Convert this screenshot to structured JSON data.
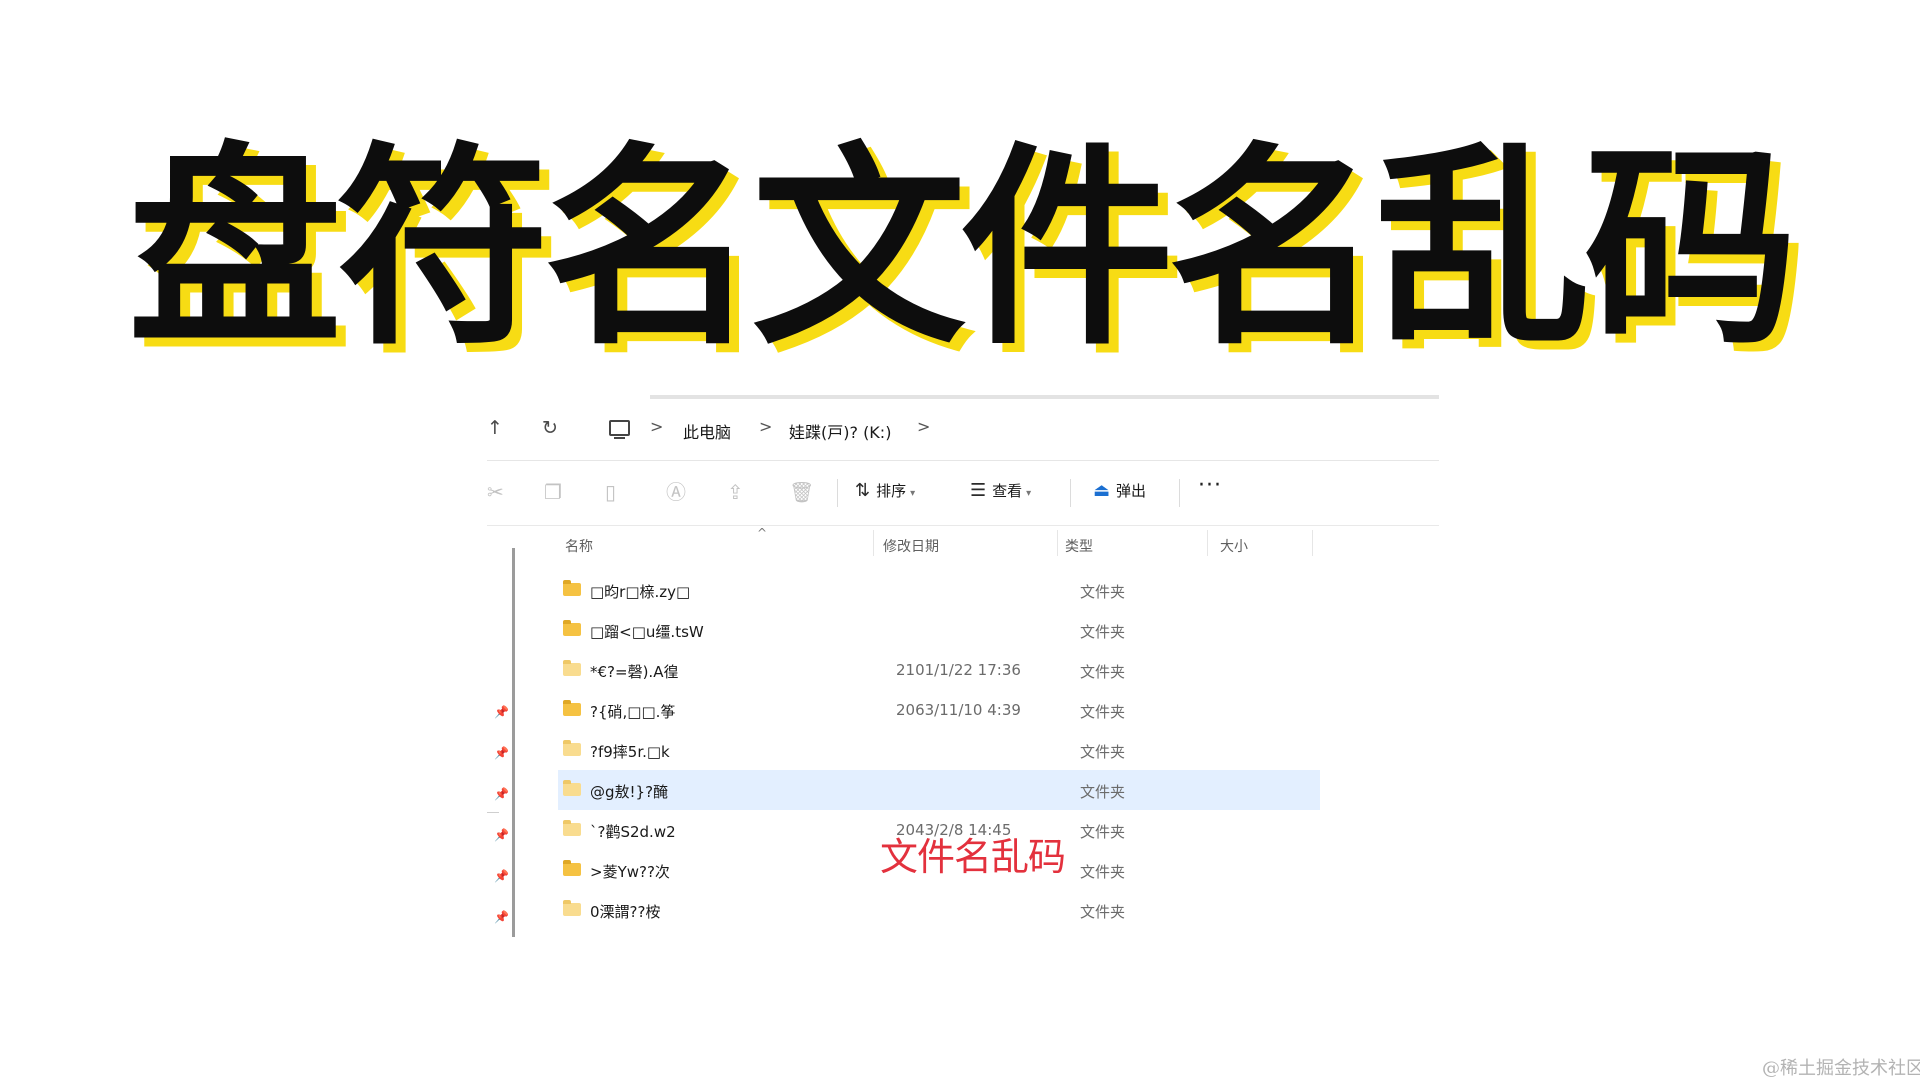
{
  "headline": "盘符名文件名乱码",
  "annotation": "文件名乱码",
  "watermark": "@稀土掘金技术社区",
  "explorer": {
    "nav": {
      "up_icon": "↑",
      "refresh_icon": "↻"
    },
    "breadcrumb": {
      "separator": ">",
      "items": [
        "此电脑",
        "娃蹀(戸)? (K:)"
      ]
    },
    "toolbar": {
      "sort_label": "排序",
      "view_label": "查看",
      "eject_label": "弹出",
      "more_label": "···",
      "icons": [
        "cut-icon",
        "copy-icon",
        "paste-icon",
        "rename-icon",
        "share-icon",
        "delete-icon"
      ]
    },
    "columns": {
      "name": "名称",
      "modified": "修改日期",
      "type": "类型",
      "size": "大小"
    },
    "files": [
      {
        "name": "□昀r□榇.zy□",
        "date": "",
        "type": "文件夹"
      },
      {
        "name": "□蹓<□u缰.tsW",
        "date": "",
        "type": "文件夹"
      },
      {
        "name": "*€?=磬).A徨",
        "date": "2101/1/22 17:36",
        "type": "文件夹"
      },
      {
        "name": "?{硝,□□.筝",
        "date": "2063/11/10 4:39",
        "type": "文件夹"
      },
      {
        "name": "?f9摔5r.□k",
        "date": "",
        "type": "文件夹"
      },
      {
        "name": "@g敖!}?醃",
        "date": "",
        "type": "文件夹",
        "selected": true
      },
      {
        "name": "`?鹳S2d.w2",
        "date": "2043/2/8 14:45",
        "type": "文件夹"
      },
      {
        "name": ">菱Yw??次",
        "date": "",
        "type": "文件夹"
      },
      {
        "name": "0溧謂??桉",
        "date": "",
        "type": "文件夹"
      }
    ]
  },
  "colors": {
    "headline": "#0d0d0d",
    "headline_shadow": "#f7dc14",
    "annotation": "#e3313d",
    "selection": "#e3efff",
    "folder": "#f5c242"
  }
}
